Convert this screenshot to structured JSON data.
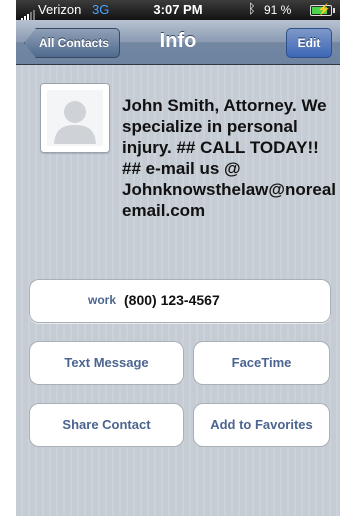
{
  "status_bar": {
    "carrier": "Verizon",
    "network": "3G",
    "time": "3:07 PM",
    "bluetooth_icon": "bluetooth-icon",
    "battery_percent": "91 %",
    "battery_level": 0.91
  },
  "nav": {
    "back_label": "All Contacts",
    "title": "Info",
    "edit_label": "Edit"
  },
  "contact": {
    "photo_icon": "person-silhouette-icon",
    "name": "John Smith, Attorney. We specialize in personal injury. ## CALL TODAY!! ## e-mail us @ Johnknowsthelaw@norealemail.com",
    "phone": {
      "label": "work",
      "number": "(800) 123-4567"
    }
  },
  "actions": {
    "text_message": "Text Message",
    "facetime": "FaceTime",
    "share_contact": "Share Contact",
    "add_to_favorites": "Add to Favorites"
  },
  "colors": {
    "nav_bar": "#6d83a1",
    "edit_button": "#3d67b6",
    "background": "#c5ccd4",
    "label_blue": "#4c6590"
  }
}
